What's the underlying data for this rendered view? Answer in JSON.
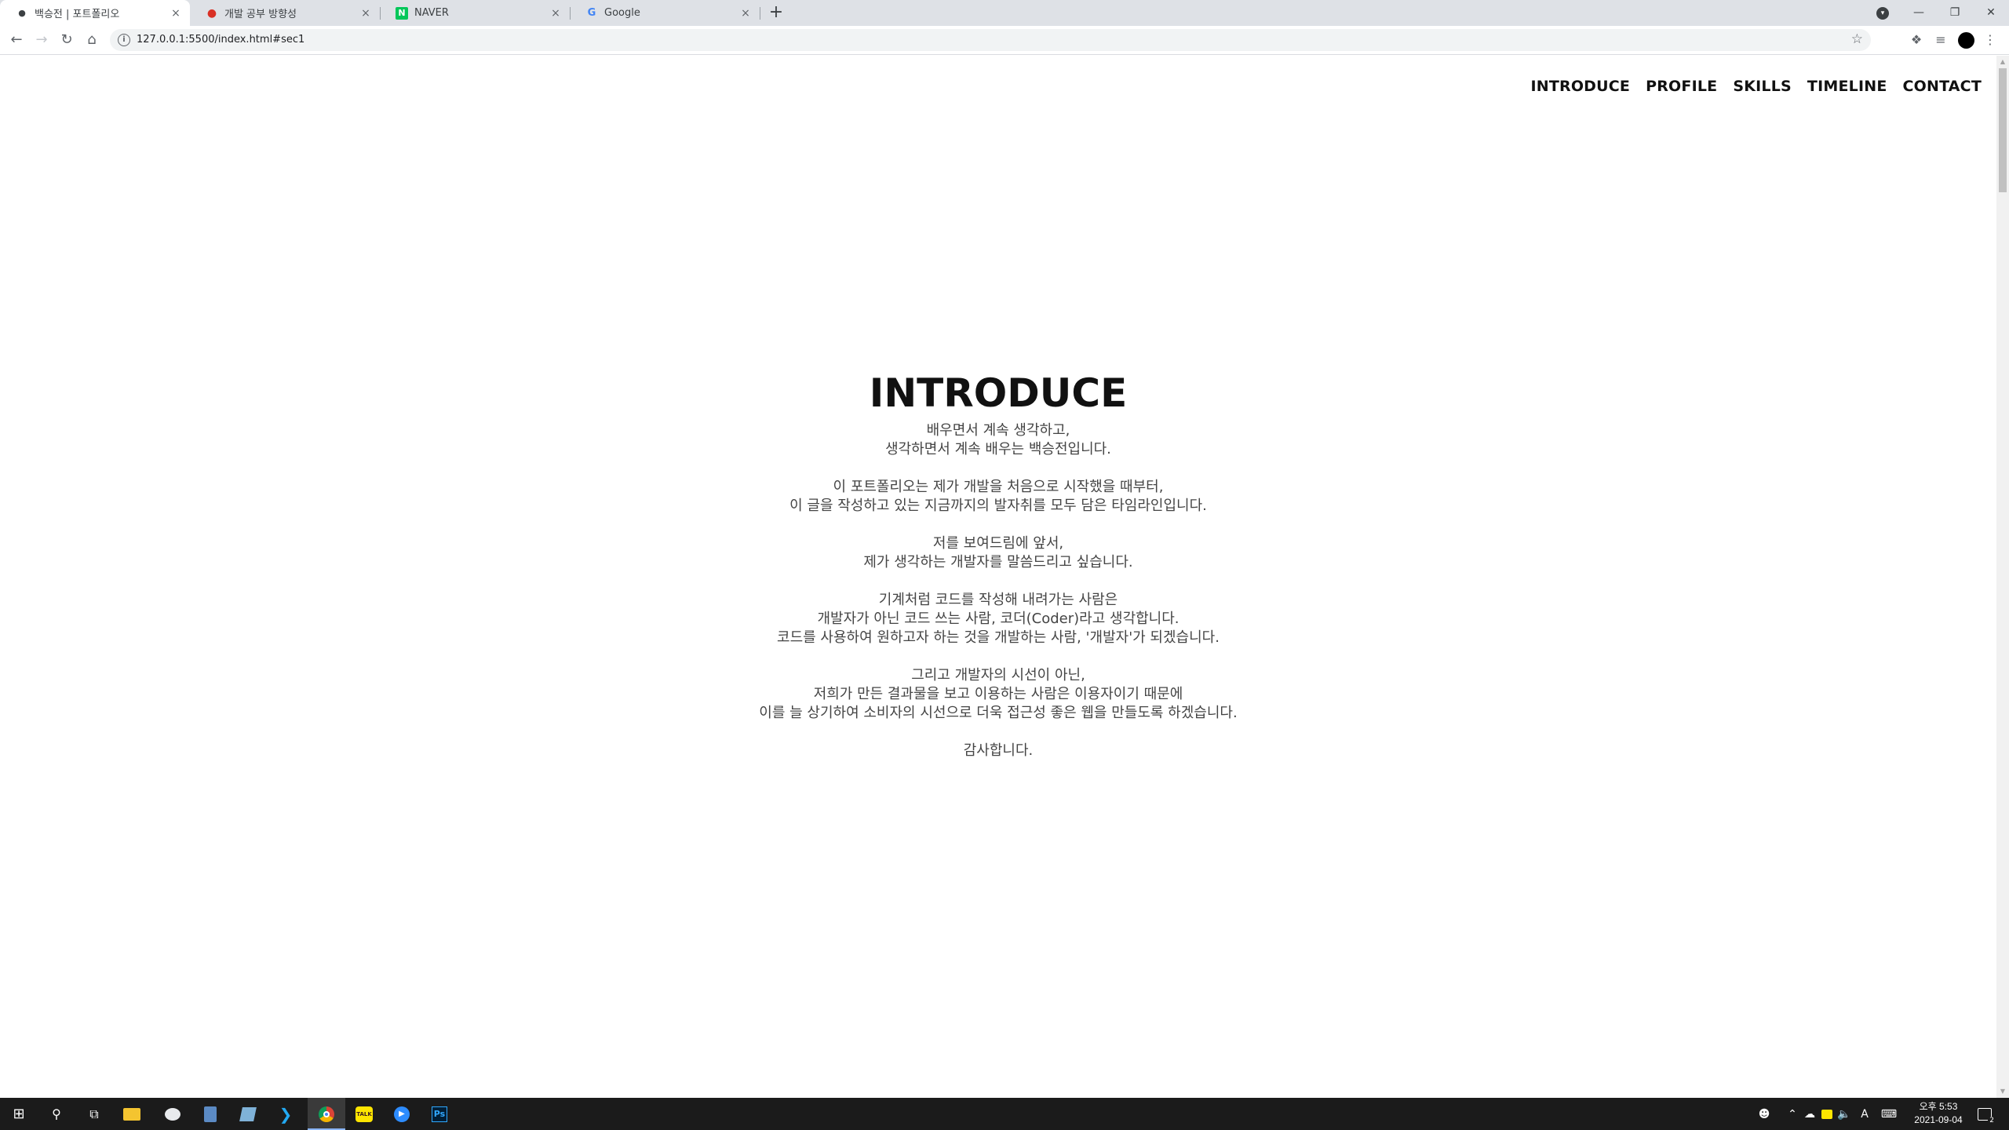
{
  "browser": {
    "tabs": [
      {
        "title": "백승전 | 포트폴리오",
        "favicon": "person-icon",
        "active": true
      },
      {
        "title": "개발 공부 방향성",
        "favicon": "apple-icon",
        "active": false
      },
      {
        "title": "NAVER",
        "favicon": "naver-n-icon",
        "active": false
      },
      {
        "title": "Google",
        "favicon": "google-g-icon",
        "active": false
      }
    ],
    "close_glyph": "×",
    "newtab_glyph": "+",
    "url": "127.0.0.1:5500/index.html#sec1"
  },
  "site": {
    "nav": [
      "INTRODUCE",
      "PROFILE",
      "SKILLS",
      "TIMELINE",
      "CONTACT"
    ],
    "intro": {
      "heading": "INTRODUCE",
      "paragraphs": [
        [
          "배우면서 계속 생각하고,",
          "생각하면서 계속 배우는 백승전입니다."
        ],
        [
          "이 포트폴리오는 제가 개발을 처음으로 시작했을 때부터,",
          "이 글을 작성하고 있는 지금까지의 발자취를 모두 담은 타임라인입니다."
        ],
        [
          "저를 보여드림에 앞서,",
          "제가 생각하는 개발자를 말씀드리고 싶습니다."
        ],
        [
          "기계처럼 코드를 작성해 내려가는 사람은",
          "개발자가 아닌 코드 쓰는 사람, 코더(Coder)라고 생각합니다.",
          "코드를 사용하여 원하고자 하는 것을 개발하는 사람, '개발자'가 되겠습니다."
        ],
        [
          "그리고 개발자의 시선이 아닌,",
          "저희가 만든 결과물을 보고 이용하는 사람은 이용자이기 때문에",
          "이를 늘 상기하여 소비자의 시선으로 더욱 접근성 좋은 웹을 만들도록 하겠습니다."
        ],
        [
          "감사합니다."
        ]
      ]
    }
  },
  "taskbar": {
    "apps": [
      "windows-start-icon",
      "search-icon",
      "task-view-icon",
      "file-explorer-icon",
      "paint-icon",
      "calculator-icon",
      "app-icon",
      "vscode-icon",
      "chrome-icon",
      "kakaotalk-icon",
      "zoom-icon",
      "photoshop-icon"
    ],
    "kakaotalk_label": "TALK",
    "photoshop_label": "Ps",
    "ime_label": "A",
    "clock": {
      "time": "오후 5:53",
      "date": "2021-09-04"
    },
    "notification_count": "2"
  }
}
